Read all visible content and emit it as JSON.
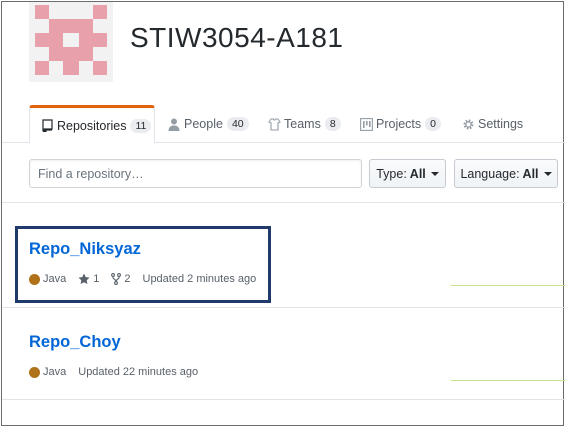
{
  "org": {
    "name": "STIW3054-A181"
  },
  "tabs": [
    {
      "label": "Repositories",
      "count": "11",
      "icon": "repo-icon"
    },
    {
      "label": "People",
      "count": "40",
      "icon": "person-icon"
    },
    {
      "label": "Teams",
      "count": "8",
      "icon": "jersey-icon"
    },
    {
      "label": "Projects",
      "count": "0",
      "icon": "project-icon"
    },
    {
      "label": "Settings",
      "icon": "gear-icon"
    }
  ],
  "search": {
    "placeholder": "Find a repository…"
  },
  "filters": {
    "type": {
      "label": "Type:",
      "value": "All"
    },
    "language": {
      "label": "Language:",
      "value": "All"
    }
  },
  "repos": [
    {
      "name": "Repo_Niksyaz",
      "language": "Java",
      "language_color": "#b07219",
      "stars": "1",
      "forks": "2",
      "updated": "Updated 2 minutes ago"
    },
    {
      "name": "Repo_Choy",
      "language": "Java",
      "language_color": "#b07219",
      "updated": "Updated 22 minutes ago"
    }
  ],
  "colors": {
    "accent": "#e36209",
    "link": "#0366d6",
    "highlight": "#1f3a6b",
    "avatar": "#e8a0aa"
  }
}
